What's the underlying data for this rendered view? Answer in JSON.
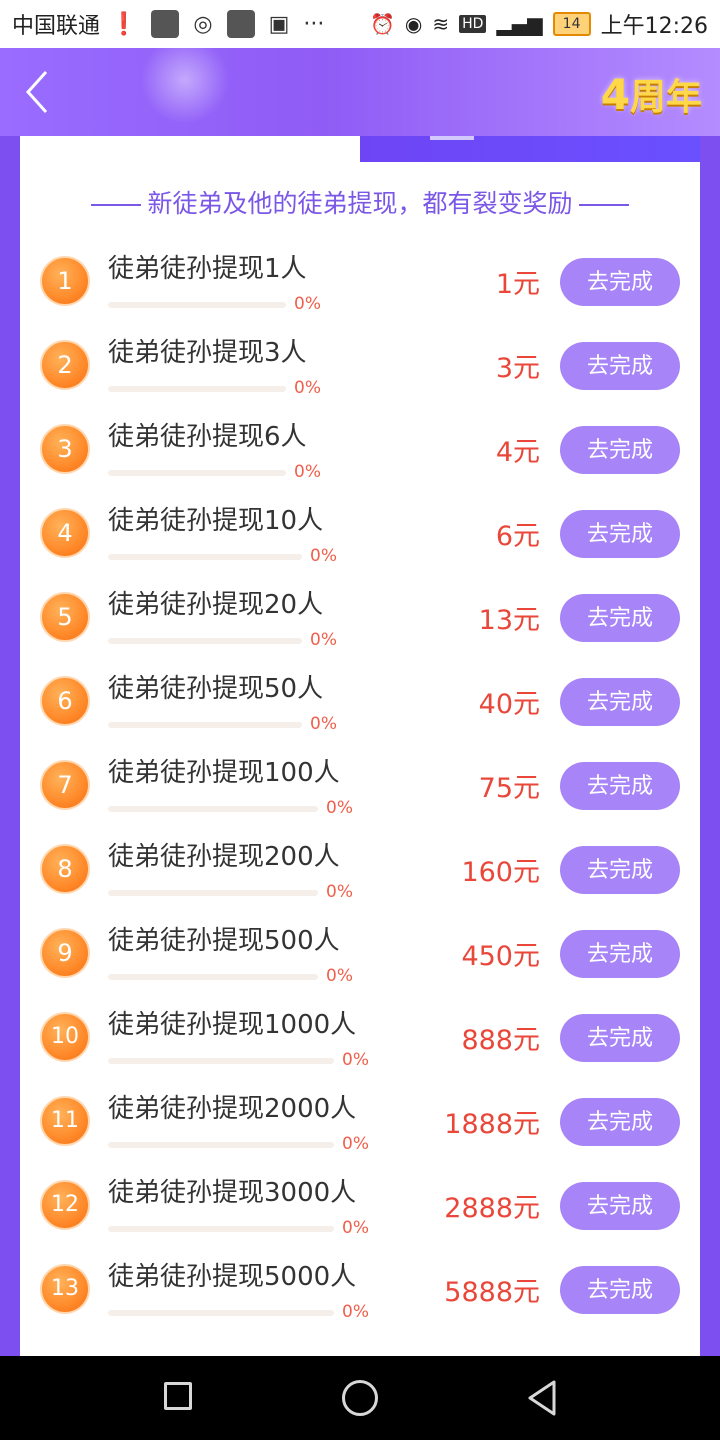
{
  "status_bar": {
    "carrier": "中国联通",
    "icons": [
      "alert-icon",
      "app-icon",
      "hotspot-icon",
      "app-icon",
      "image-icon",
      "more-icon",
      "alarm-icon",
      "eye-icon",
      "wifi-icon",
      "hd-icon",
      "signal-4g-icon"
    ],
    "battery": "14",
    "time": "上午12:26"
  },
  "header": {
    "back_icon": "chevron-left-icon",
    "badge_number": "4",
    "badge_text": "周年",
    "colors": {
      "gradient_start": "#9a6cff",
      "gradient_end": "#b58cff",
      "badge": "#ffd84a"
    }
  },
  "card": {
    "subtitle": "新徒弟及他的徒弟提现，都有裂变奖励",
    "button_label": "去完成",
    "tasks": [
      {
        "index": "1",
        "label": "徒弟徒孙提现1人",
        "progress_text": "0%",
        "progress": 0,
        "reward": "1元"
      },
      {
        "index": "2",
        "label": "徒弟徒孙提现3人",
        "progress_text": "0%",
        "progress": 0,
        "reward": "3元"
      },
      {
        "index": "3",
        "label": "徒弟徒孙提现6人",
        "progress_text": "0%",
        "progress": 0,
        "reward": "4元"
      },
      {
        "index": "4",
        "label": "徒弟徒孙提现10人",
        "progress_text": "0%",
        "progress": 0,
        "reward": "6元"
      },
      {
        "index": "5",
        "label": "徒弟徒孙提现20人",
        "progress_text": "0%",
        "progress": 0,
        "reward": "13元"
      },
      {
        "index": "6",
        "label": "徒弟徒孙提现50人",
        "progress_text": "0%",
        "progress": 0,
        "reward": "40元"
      },
      {
        "index": "7",
        "label": "徒弟徒孙提现100人",
        "progress_text": "0%",
        "progress": 0,
        "reward": "75元"
      },
      {
        "index": "8",
        "label": "徒弟徒孙提现200人",
        "progress_text": "0%",
        "progress": 0,
        "reward": "160元"
      },
      {
        "index": "9",
        "label": "徒弟徒孙提现500人",
        "progress_text": "0%",
        "progress": 0,
        "reward": "450元"
      },
      {
        "index": "10",
        "label": "徒弟徒孙提现1000人",
        "progress_text": "0%",
        "progress": 0,
        "reward": "888元"
      },
      {
        "index": "11",
        "label": "徒弟徒孙提现2000人",
        "progress_text": "0%",
        "progress": 0,
        "reward": "1888元"
      },
      {
        "index": "12",
        "label": "徒弟徒孙提现3000人",
        "progress_text": "0%",
        "progress": 0,
        "reward": "2888元"
      },
      {
        "index": "13",
        "label": "徒弟徒孙提现5000人",
        "progress_text": "0%",
        "progress": 0,
        "reward": "5888元"
      }
    ]
  },
  "nav_bar": {
    "icons": [
      "recent-apps-icon",
      "home-icon",
      "back-triangle-icon"
    ]
  }
}
